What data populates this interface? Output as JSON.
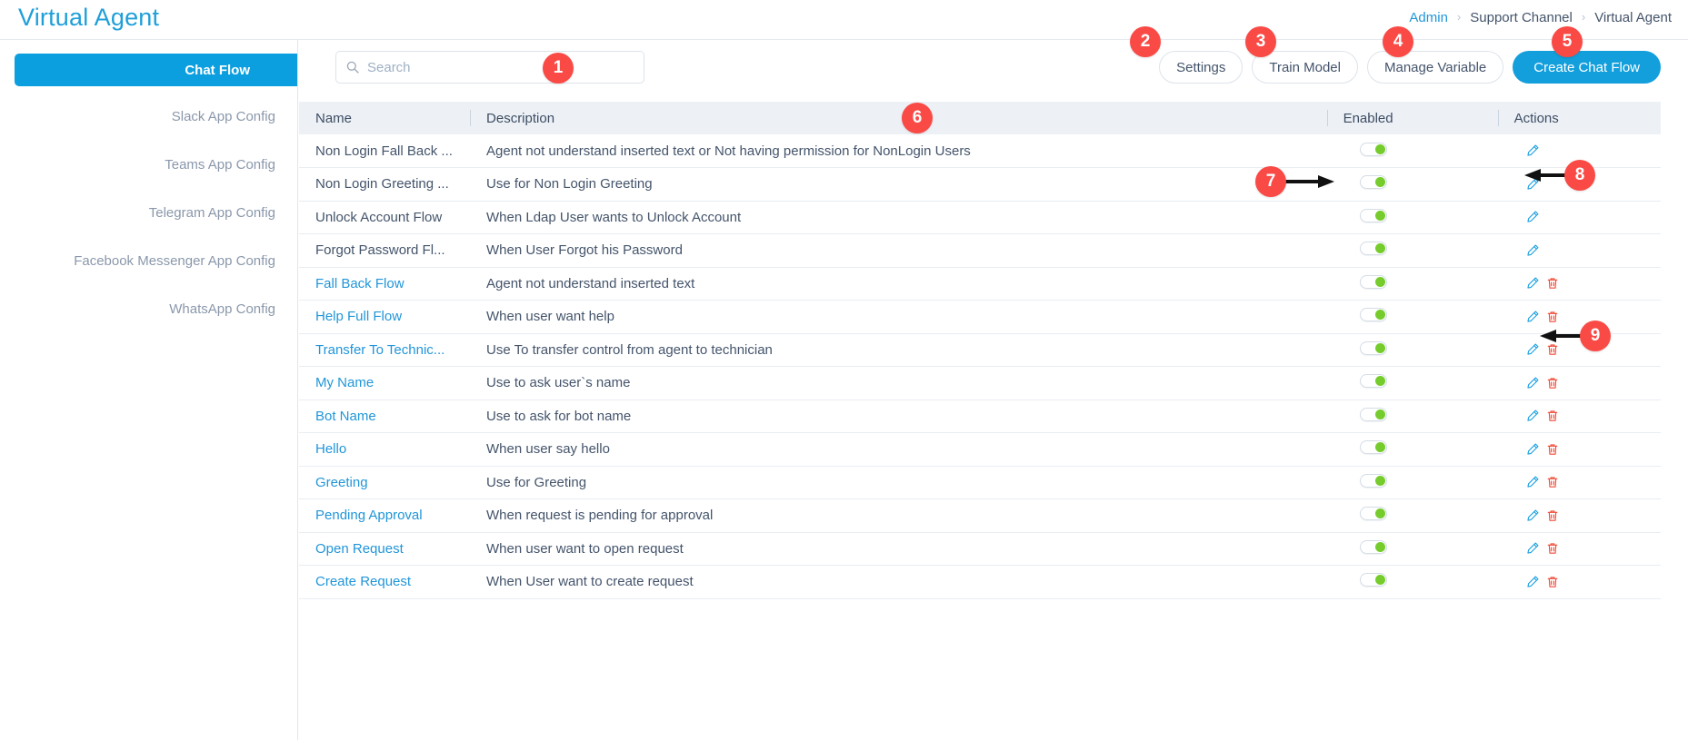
{
  "header": {
    "app_title": "Virtual Agent",
    "breadcrumb": [
      {
        "label": "Admin",
        "type": "link"
      },
      {
        "label": "Support Channel",
        "type": "text"
      },
      {
        "label": "Virtual Agent",
        "type": "current"
      }
    ],
    "separator": "›"
  },
  "sidebar": {
    "items": [
      {
        "label": "Chat Flow",
        "active": true
      },
      {
        "label": "Slack App Config",
        "active": false
      },
      {
        "label": "Teams App Config",
        "active": false
      },
      {
        "label": "Telegram App Config",
        "active": false
      },
      {
        "label": "Facebook Messenger App Config",
        "active": false
      },
      {
        "label": "WhatsApp Config",
        "active": false
      }
    ]
  },
  "toolbar": {
    "search_placeholder": "Search",
    "search_value": "",
    "settings_label": "Settings",
    "train_model_label": "Train Model",
    "manage_variable_label": "Manage Variable",
    "create_chat_flow_label": "Create Chat Flow"
  },
  "table": {
    "columns": [
      "Name",
      "Description",
      "Enabled",
      "Actions"
    ],
    "rows": [
      {
        "name": "Non Login Fall Back ...",
        "description": "Agent not understand inserted text or Not having permission for NonLogin Users",
        "enabled": true,
        "link": false,
        "deletable": false
      },
      {
        "name": "Non Login Greeting ...",
        "description": "Use for Non Login Greeting",
        "enabled": true,
        "link": false,
        "deletable": false
      },
      {
        "name": "Unlock Account Flow",
        "description": "When Ldap User wants to Unlock Account",
        "enabled": true,
        "link": false,
        "deletable": false
      },
      {
        "name": "Forgot Password Fl...",
        "description": "When User Forgot his Password",
        "enabled": true,
        "link": false,
        "deletable": false
      },
      {
        "name": "Fall Back Flow",
        "description": "Agent not understand inserted text",
        "enabled": true,
        "link": true,
        "deletable": true
      },
      {
        "name": "Help Full Flow",
        "description": "When user want help",
        "enabled": true,
        "link": true,
        "deletable": true
      },
      {
        "name": "Transfer To Technic...",
        "description": "Use To transfer control from agent to technician",
        "enabled": true,
        "link": true,
        "deletable": true
      },
      {
        "name": "My Name",
        "description": "Use to ask user`s name",
        "enabled": true,
        "link": true,
        "deletable": true
      },
      {
        "name": "Bot Name",
        "description": "Use to ask for bot name",
        "enabled": true,
        "link": true,
        "deletable": true
      },
      {
        "name": "Hello",
        "description": "When user say hello",
        "enabled": true,
        "link": true,
        "deletable": true
      },
      {
        "name": "Greeting",
        "description": "Use for Greeting",
        "enabled": true,
        "link": true,
        "deletable": true
      },
      {
        "name": "Pending Approval",
        "description": "When request is pending for approval",
        "enabled": true,
        "link": true,
        "deletable": true
      },
      {
        "name": "Open Request",
        "description": "When user want to open request",
        "enabled": true,
        "link": true,
        "deletable": true
      },
      {
        "name": "Create Request",
        "description": "When User want to create request",
        "enabled": true,
        "link": true,
        "deletable": true
      }
    ]
  },
  "annotations": {
    "markers": [
      {
        "number": "1",
        "target": "search-input"
      },
      {
        "number": "2",
        "target": "settings-button"
      },
      {
        "number": "3",
        "target": "train-model-button"
      },
      {
        "number": "4",
        "target": "manage-variable-button"
      },
      {
        "number": "5",
        "target": "create-chat-flow-button"
      },
      {
        "number": "6",
        "target": "flows-table"
      },
      {
        "number": "7",
        "target": "enabled-toggle"
      },
      {
        "number": "8",
        "target": "edit-icon"
      },
      {
        "number": "9",
        "target": "delete-icon"
      }
    ]
  },
  "colors": {
    "brand_blue": "#129fdc",
    "link_blue": "#2196d9",
    "marker_red": "#f94a46",
    "toggle_green": "#76cc2c",
    "delete_red": "#ef4a36",
    "header_band": "#edf1f6"
  }
}
